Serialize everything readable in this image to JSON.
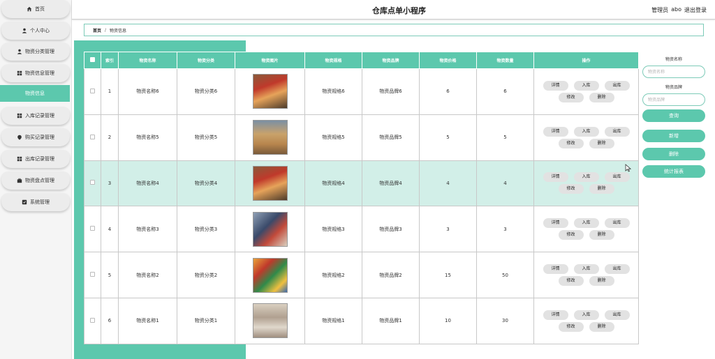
{
  "app": {
    "title": "仓库点单小程序"
  },
  "user": {
    "role": "管理员",
    "name": "abo",
    "logout": "退出登录"
  },
  "sidebar": {
    "items": [
      {
        "label": "首页",
        "icon": "home-icon"
      },
      {
        "label": "个人中心",
        "icon": "user-icon"
      },
      {
        "label": "物资分类管理",
        "icon": "user-icon"
      },
      {
        "label": "物资信息管理",
        "icon": "grid-icon"
      },
      {
        "label": "物资信息",
        "icon": "",
        "active": true
      },
      {
        "label": "入库记录管理",
        "icon": "grid-icon"
      },
      {
        "label": "购买记录管理",
        "icon": "pin-icon"
      },
      {
        "label": "出库记录管理",
        "icon": "grid-icon"
      },
      {
        "label": "物资盘点管理",
        "icon": "briefcase-icon"
      },
      {
        "label": "系统管理",
        "icon": "settings-icon"
      }
    ]
  },
  "breadcrumb": {
    "home": "首页",
    "separator": "/",
    "current": "物资信息"
  },
  "table": {
    "headers": [
      "索引",
      "物资名称",
      "物资分类",
      "物资图片",
      "物资规格",
      "物资品牌",
      "物资价格",
      "物资数量",
      "操作"
    ],
    "rows": [
      {
        "index": "1",
        "name": "物资名称6",
        "category": "物资分类6",
        "spec": "物资规格6",
        "brand": "物资品牌6",
        "price": "6",
        "qty": "6"
      },
      {
        "index": "2",
        "name": "物资名称5",
        "category": "物资分类5",
        "spec": "物资规格5",
        "brand": "物资品牌5",
        "price": "5",
        "qty": "5"
      },
      {
        "index": "3",
        "name": "物资名称4",
        "category": "物资分类4",
        "spec": "物资规格4",
        "brand": "物资品牌4",
        "price": "4",
        "qty": "4"
      },
      {
        "index": "4",
        "name": "物资名称3",
        "category": "物资分类3",
        "spec": "物资规格3",
        "brand": "物资品牌3",
        "price": "3",
        "qty": "3"
      },
      {
        "index": "5",
        "name": "物资名称2",
        "category": "物资分类2",
        "spec": "物资规格2",
        "brand": "物资品牌2",
        "price": "15",
        "qty": "50"
      },
      {
        "index": "6",
        "name": "物资名称1",
        "category": "物资分类1",
        "spec": "物资规格1",
        "brand": "物资品牌1",
        "price": "10",
        "qty": "30"
      }
    ],
    "actions": {
      "detail": "详情",
      "inbound": "入库",
      "outbound": "出库",
      "edit": "修改",
      "delete": "删除"
    }
  },
  "search": {
    "name_label": "物资名称",
    "name_placeholder": "物资名称",
    "brand_label": "物资品牌",
    "brand_placeholder": "物资品牌",
    "query": "查询",
    "add": "新增",
    "delete": "删除",
    "report": "统计报表"
  },
  "colors": {
    "accent": "#5cc8ad",
    "highlight": "#d2efe8"
  }
}
